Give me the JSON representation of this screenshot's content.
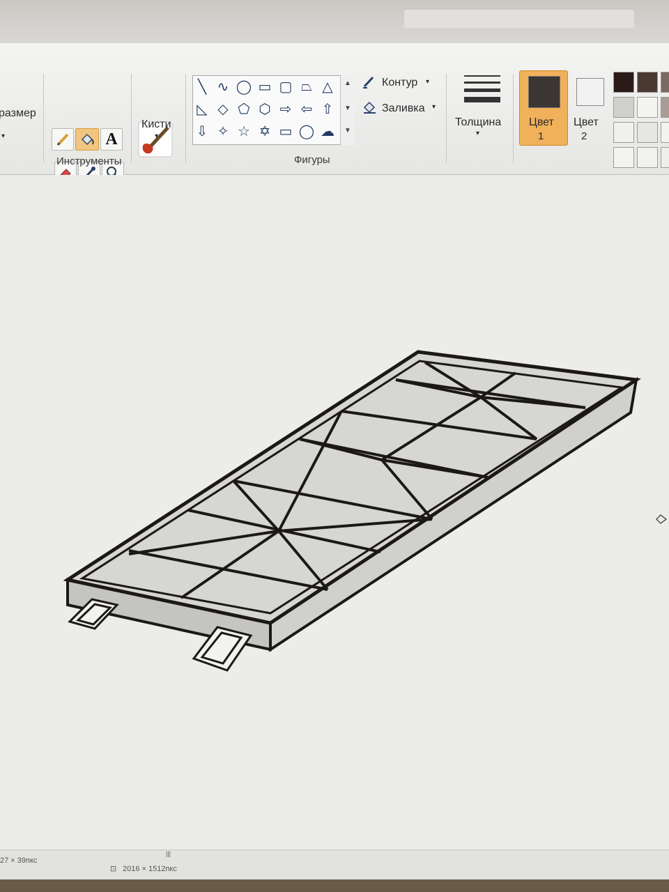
{
  "ribbon": {
    "image_group": {
      "resize_label": "размер"
    },
    "tools_group": {
      "label": "Инструменты",
      "tools": [
        {
          "name": "pencil",
          "icon": "pencil-icon"
        },
        {
          "name": "fill",
          "icon": "fill-bucket-icon",
          "selected": true
        },
        {
          "name": "text",
          "icon": "text-icon",
          "glyph": "A"
        },
        {
          "name": "eraser",
          "icon": "eraser-icon"
        },
        {
          "name": "color-picker",
          "icon": "color-picker-icon"
        },
        {
          "name": "magnifier",
          "icon": "magnifier-icon"
        }
      ]
    },
    "brushes": {
      "label": "Кисти"
    },
    "shapes_group": {
      "label": "Фигуры",
      "outline_label": "Контур",
      "fill_label": "Заливка"
    },
    "size": {
      "label": "Толщина"
    },
    "color1": {
      "label_line1": "Цвет",
      "label_line2": "1",
      "value": "#3b3633"
    },
    "color2": {
      "label_line1": "Цвет",
      "label_line2": "2",
      "value": "#f2f2f2"
    },
    "palette": [
      "#2a1a16",
      "#4a3a32",
      "#7a6a60",
      "#d0d0ce",
      "#f4f4f2",
      "#a89c94",
      "#f0f0ee",
      "#e6e6e4",
      "#f2f2f0",
      "#f3f3f1",
      "#f1f1ef",
      "#eeeeec"
    ]
  },
  "status_bar": {
    "cursor_pos": "27 × 39пкс",
    "image_size": "2016 × 1512пкс"
  },
  "colors": {
    "selected_tool": "#f1c680",
    "frame_fill": "#c8c8c6",
    "frame_stroke": "#1c1818"
  }
}
